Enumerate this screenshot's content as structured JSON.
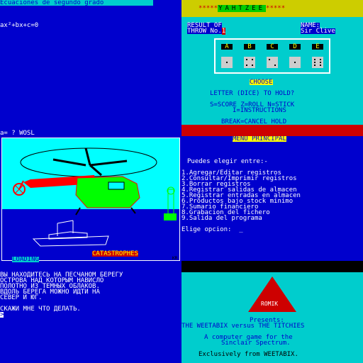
{
  "equations": {
    "title": "Ecuaciones de segundo grado",
    "formula": "ax²+bx+c=0",
    "prompt": "a= ? WOSL"
  },
  "yahtzee": {
    "title": "YAHTZEE",
    "stars_left": "*****",
    "stars_right": "*****",
    "result_label": "RESULT OF",
    "throw_label": "THROW No.",
    "throw_number": "1",
    "name_label": "NAME:",
    "player_name": "Sir Clive",
    "dice": [
      {
        "letter": "A",
        "value": 1
      },
      {
        "letter": "B",
        "value": 4
      },
      {
        "letter": "C",
        "value": 2
      },
      {
        "letter": "D",
        "value": 1
      },
      {
        "letter": "E",
        "value": 6
      }
    ],
    "choose": "CHOOSE",
    "question": "LETTER (DICE) TO HOLD?",
    "help_line1": "S=SCORE Z=ROLL N=STICK",
    "help_line2": "I=INSTRUCTIONS",
    "break_line": "BREAK=CANCEL HOLD"
  },
  "picture": {
    "loading": "LOADING",
    "title": "CATASTROPHES",
    "corner": "KR"
  },
  "menu": {
    "title": "MENU PRINCIPAL",
    "intro": "Puedes elegir entre:-",
    "items": [
      "1.Agregar/Editar registros",
      "2.Consultar/Imprimir registros",
      "3.Borrar registros",
      "4.Registrar salidas de almacen",
      "5.Registrar entradas en almacen",
      "6.Productos bajo stock minimo",
      "7.Sumario financiero",
      "8.Grabacion del fichero",
      "9.Salida del programa"
    ],
    "prompt": "Elige opcion:",
    "cursor": "_"
  },
  "adventure": {
    "lines": [
      "ВЫ НАХОДИТЕСЬ НА ПЕСЧАНОМ БЕРЕГУ",
      "ОСТРОВА НАД КОТОРЫМ НАВИСЛО",
      "ПОЛОТНО ИЗ ТЕМНЫХ ОБЛАКОВ.",
      "ВДОЛЬ БЕРЕГА МОЖНО ИДТИ НА",
      "СЕВЕР И ЮГ."
    ],
    "prompt": "СКАЖИ МНЕ ЧТО ДЕЛАТЬ.",
    "cursor": ">"
  },
  "romik": {
    "logo": "ROMIK",
    "presents": "Presents:",
    "game_title": "THE WEETABIX versus THE TITCHIES",
    "desc1": "A computer game for the",
    "desc2": "Sinclair Spectrum.",
    "exclusive": "Exclusively from WEETABIX."
  }
}
